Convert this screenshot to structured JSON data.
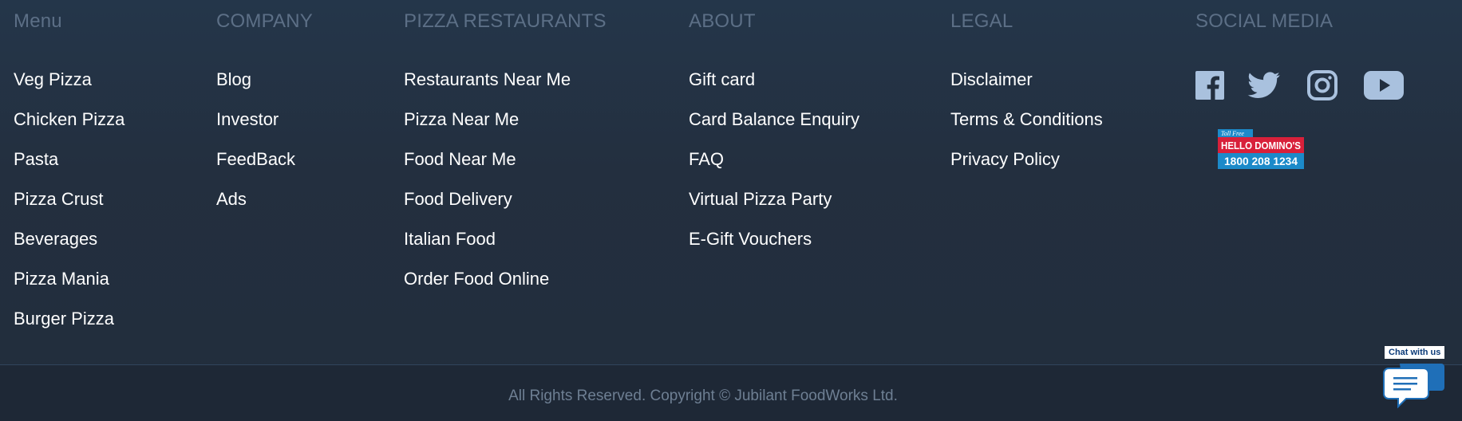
{
  "columns": {
    "menu": {
      "title": "Menu",
      "items": [
        "Veg Pizza",
        "Chicken Pizza",
        "Pasta",
        "Pizza Crust",
        "Beverages",
        "Pizza Mania",
        "Burger Pizza"
      ]
    },
    "company": {
      "title": "COMPANY",
      "items": [
        "Blog",
        "Investor",
        "FeedBack",
        "Ads"
      ]
    },
    "restaurants": {
      "title": "PIZZA RESTAURANTS",
      "items": [
        "Restaurants Near Me",
        "Pizza Near Me",
        "Food Near Me",
        "Food Delivery",
        "Italian Food",
        "Order Food Online"
      ]
    },
    "about": {
      "title": "ABOUT",
      "items": [
        "Gift card",
        "Card Balance Enquiry",
        "FAQ",
        "Virtual Pizza Party",
        "E-Gift Vouchers"
      ]
    },
    "legal": {
      "title": "LEGAL",
      "items": [
        "Disclaimer",
        "Terms & Conditions",
        "Privacy Policy"
      ]
    },
    "social": {
      "title": "SOCIAL MEDIA",
      "icons": [
        "facebook-icon",
        "twitter-icon",
        "instagram-icon",
        "youtube-icon"
      ],
      "tollfree": {
        "tag": "Toll Free",
        "line1": "HELLO DOMINO'S",
        "line2": "1800 208 1234"
      }
    }
  },
  "footer": {
    "copyright": "All Rights Reserved. Copyright © Jubilant FoodWorks Ltd."
  },
  "chat": {
    "label": "Chat with us"
  },
  "colors": {
    "background": "#232f3f",
    "heading": "#5c6f86",
    "link": "#ffffff",
    "icon": "#a9c1de",
    "chat": "#1f6fb8",
    "tollfree_red": "#d8203a",
    "tollfree_blue": "#1c8ac9"
  }
}
